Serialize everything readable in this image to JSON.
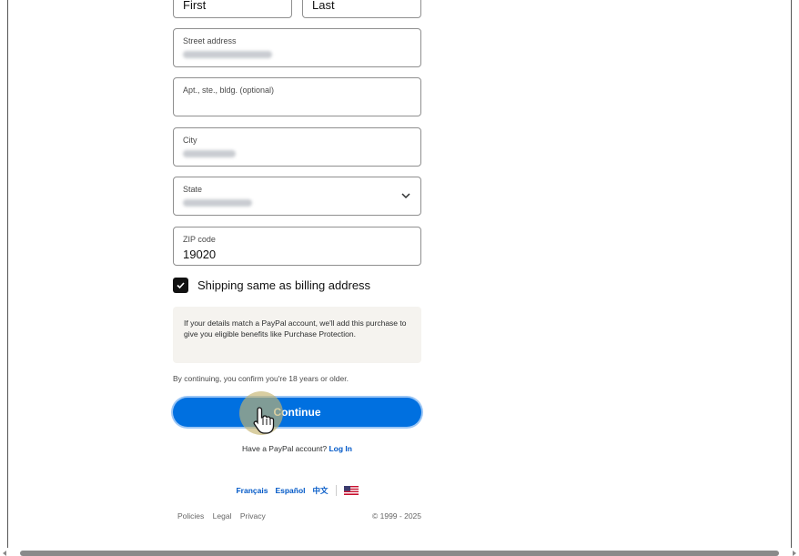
{
  "form": {
    "first_name_placeholder": "First",
    "last_name_placeholder": "Last",
    "street_label": "Street address",
    "apt_label": "Apt., ste., bldg. (optional)",
    "city_label": "City",
    "state_label": "State",
    "zip_label": "ZIP code",
    "zip_value": "19020",
    "shipping_same_label": "Shipping same as billing address",
    "shipping_same_checked": true
  },
  "info": {
    "text": "If your details match a PayPal account, we'll add this purchase to give you eligible benefits like Purchase Protection."
  },
  "age_note": "By continuing, you confirm you're 18 years or older.",
  "continue_label": "Continue",
  "login": {
    "prompt": "Have a PayPal account?",
    "link": "Log In"
  },
  "languages": [
    "Français",
    "Español",
    "中文"
  ],
  "footer": {
    "links": [
      "Policies",
      "Legal",
      "Privacy"
    ],
    "copyright": "© 1999 - 2025"
  },
  "colors": {
    "accent": "#0070e0",
    "link": "#0058c7",
    "info_bg": "#f5f3ef"
  }
}
